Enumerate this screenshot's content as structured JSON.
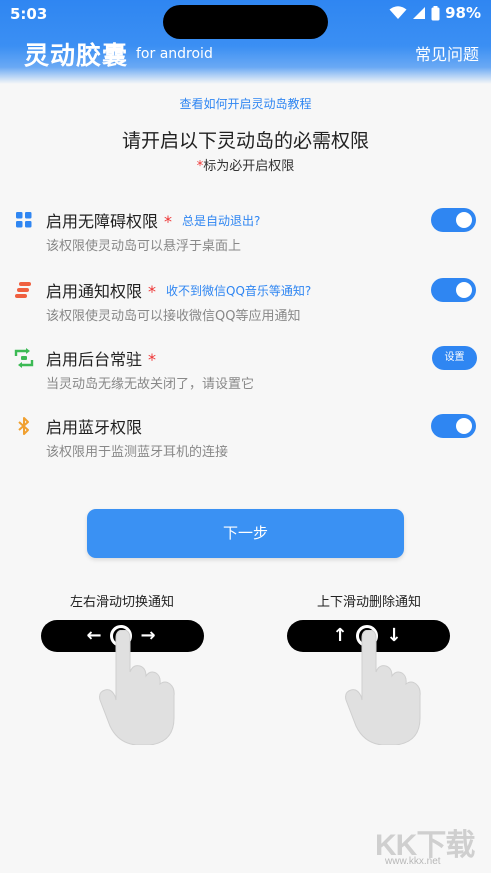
{
  "status_bar": {
    "time": "5:03",
    "battery": "98%"
  },
  "header": {
    "title": "灵动胶囊",
    "subtitle": "for android",
    "faq_label": "常见问题"
  },
  "tutorial_link": "查看如何开启灵动岛教程",
  "main_title": "请开启以下灵动岛的必需权限",
  "required_note": {
    "star": "*",
    "text": "标为必开启权限"
  },
  "permissions": [
    {
      "title": "启用无障碍权限",
      "required": "*",
      "help": "总是自动退出?",
      "desc": "该权限使灵动岛可以悬浮于桌面上",
      "control": "toggle",
      "enabled": true,
      "icon": "grid-icon"
    },
    {
      "title": "启用通知权限",
      "required": "*",
      "help": "收不到微信QQ音乐等通知?",
      "desc": "该权限使灵动岛可以接收微信QQ等应用通知",
      "control": "toggle",
      "enabled": true,
      "icon": "notification-stack-icon"
    },
    {
      "title": "启用后台常驻",
      "required": "*",
      "help": "",
      "desc": "当灵动岛无缘无故关闭了，请设置它",
      "control": "button",
      "button_label": "设置",
      "icon": "background-sync-icon"
    },
    {
      "title": "启用蓝牙权限",
      "required": "",
      "help": "",
      "desc": "该权限用于监测蓝牙耳机的连接",
      "control": "toggle",
      "enabled": true,
      "icon": "bluetooth-icon"
    }
  ],
  "next_button": "下一步",
  "gestures": [
    {
      "label": "左右滑动切换通知",
      "icon": "left-right-arrows-icon"
    },
    {
      "label": "上下滑动删除通知",
      "icon": "up-down-arrows-icon"
    }
  ],
  "watermark": {
    "text": "KK下载",
    "url": "www.kkx.net"
  },
  "colors": {
    "accent": "#2f86f2",
    "required_star": "#e33333",
    "bluetooth": "#f0a030",
    "notif": "#f06040",
    "sync": "#3cba54"
  }
}
